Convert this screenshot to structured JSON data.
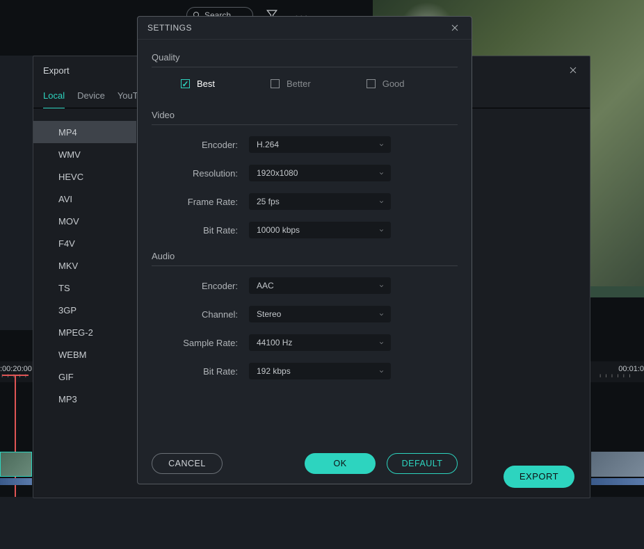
{
  "toolbar": {
    "search_label": "Search",
    "more": "•••"
  },
  "timeline": {
    "left_timecode": ":00:20:00",
    "right_timecode": "00:01:0"
  },
  "export": {
    "title": "Export",
    "tabs": [
      "Local",
      "Device",
      "YouTub"
    ],
    "active_tab": 0,
    "formats": [
      "MP4",
      "WMV",
      "HEVC",
      "AVI",
      "MOV",
      "F4V",
      "MKV",
      "TS",
      "3GP",
      "MPEG-2",
      "WEBM",
      "GIF",
      "MP3"
    ],
    "selected_format": 0,
    "export_button": "EXPORT"
  },
  "settings": {
    "title": "SETTINGS",
    "quality": {
      "label": "Quality",
      "options": [
        "Best",
        "Better",
        "Good"
      ],
      "selected": 0
    },
    "video": {
      "label": "Video",
      "encoder_label": "Encoder:",
      "encoder_value": "H.264",
      "resolution_label": "Resolution:",
      "resolution_value": "1920x1080",
      "framerate_label": "Frame Rate:",
      "framerate_value": "25 fps",
      "bitrate_label": "Bit Rate:",
      "bitrate_value": "10000 kbps"
    },
    "audio": {
      "label": "Audio",
      "encoder_label": "Encoder:",
      "encoder_value": "AAC",
      "channel_label": "Channel:",
      "channel_value": "Stereo",
      "samplerate_label": "Sample Rate:",
      "samplerate_value": "44100 Hz",
      "bitrate_label": "Bit Rate:",
      "bitrate_value": "192 kbps"
    },
    "buttons": {
      "cancel": "CANCEL",
      "ok": "OK",
      "default": "DEFAULT"
    }
  }
}
